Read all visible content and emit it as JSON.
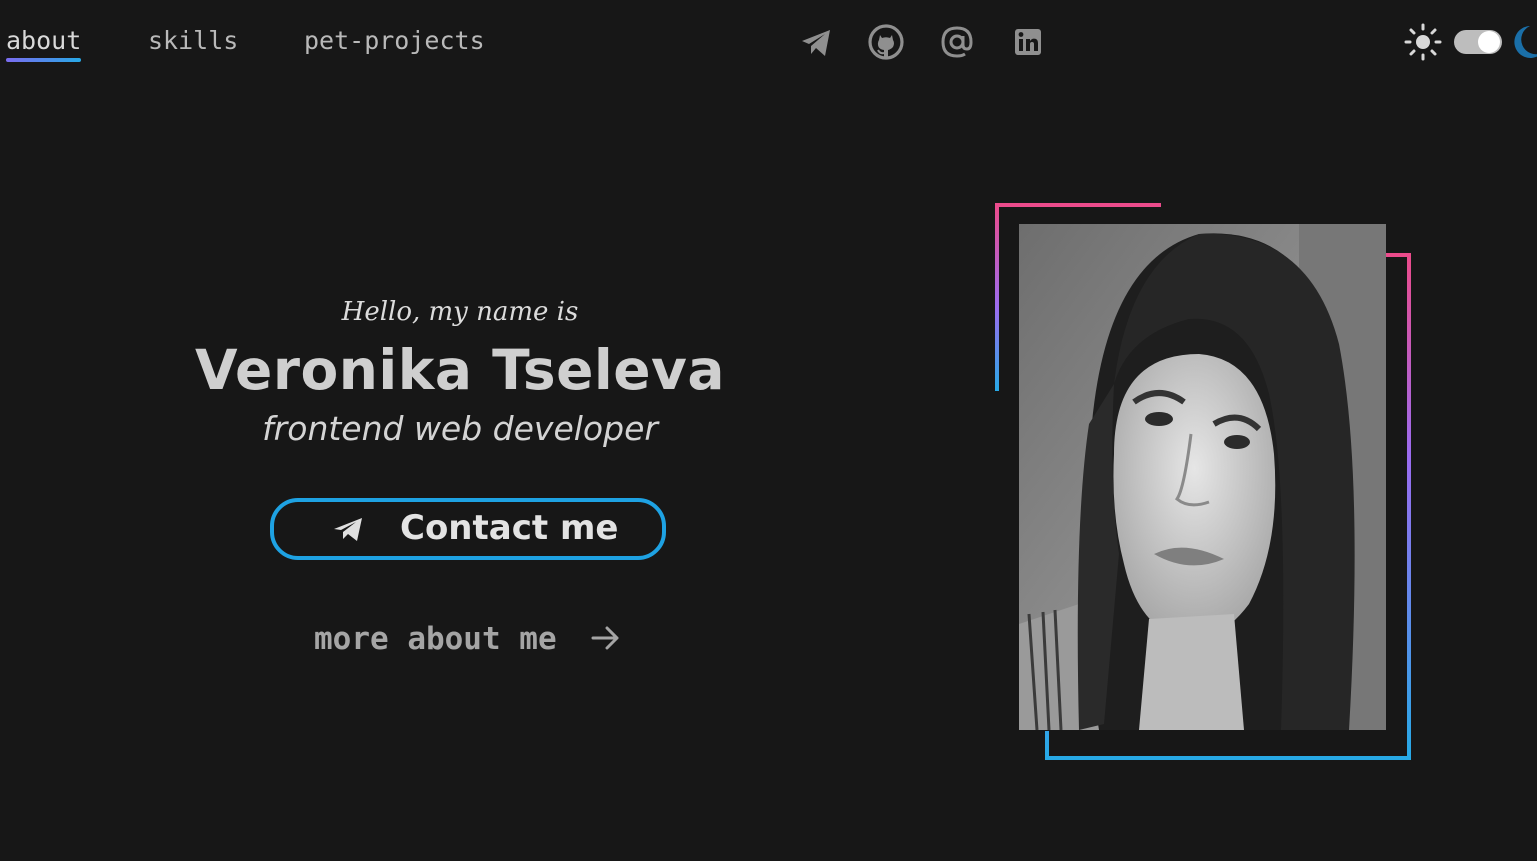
{
  "nav": {
    "links": [
      {
        "label": "about",
        "active": true
      },
      {
        "label": "skills",
        "active": false
      },
      {
        "label": "pet-projects",
        "active": false
      }
    ]
  },
  "social": {
    "icons": [
      "telegram-icon",
      "github-icon",
      "email-at-icon",
      "linkedin-icon"
    ]
  },
  "theme": {
    "mode": "dark",
    "icons": [
      "sun-icon",
      "toggle-switch",
      "moon-icon"
    ]
  },
  "hero": {
    "greeting": "Hello, my name is",
    "name": "Veronika Tseleva",
    "role": "frontend web developer",
    "contact_label": "Contact me",
    "more_label": "more about me"
  },
  "colors": {
    "background": "#171717",
    "accent_blue": "#1ea2e3",
    "accent_pink": "#ec4b8b",
    "accent_purple": "#9b6cf0"
  }
}
